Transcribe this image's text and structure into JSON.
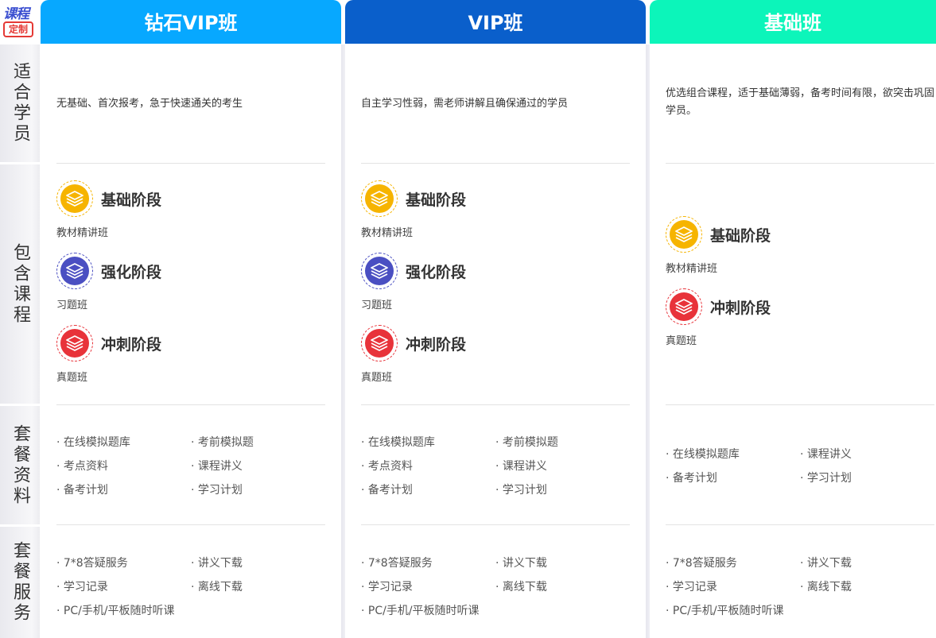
{
  "logo": {
    "line1": "课程",
    "line2": "定制"
  },
  "rows": [
    "适合学员",
    "包含课程",
    "套餐资料",
    "套餐服务"
  ],
  "columns": [
    {
      "title": "钻石VIP班",
      "header_color": "#07a8ff",
      "suitable": "无基础、首次报考，急于快速通关的考生",
      "stages": [
        {
          "name": "基础阶段",
          "desc": "教材精讲班",
          "color": "#f6b400"
        },
        {
          "name": "强化阶段",
          "desc": "习题班",
          "color": "#4a4fc2"
        },
        {
          "name": "冲刺阶段",
          "desc": "真题班",
          "color": "#e8333a"
        }
      ],
      "materials": [
        "· 在线模拟题库",
        "· 考前模拟题",
        "· 考点资料",
        "· 课程讲义",
        "· 备考计划",
        "· 学习计划"
      ],
      "services": [
        "· 7*8答疑服务",
        "· 讲义下载",
        "· 学习记录",
        "· 离线下载",
        "· PC/手机/平板随时听课"
      ]
    },
    {
      "title": "VIP班",
      "header_color": "#0a5fcb",
      "suitable": "自主学习性弱，需老师讲解且确保通过的学员",
      "stages": [
        {
          "name": "基础阶段",
          "desc": "教材精讲班",
          "color": "#f6b400"
        },
        {
          "name": "强化阶段",
          "desc": "习题班",
          "color": "#4a4fc2"
        },
        {
          "name": "冲刺阶段",
          "desc": "真题班",
          "color": "#e8333a"
        }
      ],
      "materials": [
        "· 在线模拟题库",
        "· 考前模拟题",
        "· 考点资料",
        "· 课程讲义",
        "· 备考计划",
        "· 学习计划"
      ],
      "services": [
        "· 7*8答疑服务",
        "· 讲义下载",
        "· 学习记录",
        "· 离线下载",
        "· PC/手机/平板随时听课"
      ]
    },
    {
      "title": "基础班",
      "header_color": "#0cf5ba",
      "suitable": "优选组合课程，适于基础薄弱，备考时间有限，欲突击巩固学员。",
      "stages": [
        {
          "name": "基础阶段",
          "desc": "教材精讲班",
          "color": "#f6b400"
        },
        {
          "name": "冲刺阶段",
          "desc": "真题班",
          "color": "#e8333a"
        }
      ],
      "materials": [
        "· 在线模拟题库",
        "· 课程讲义",
        "· 备考计划",
        "· 学习计划"
      ],
      "services": [
        "· 7*8答疑服务",
        "· 讲义下载",
        "· 学习记录",
        "· 离线下载",
        "· PC/手机/平板随时听课"
      ]
    }
  ]
}
